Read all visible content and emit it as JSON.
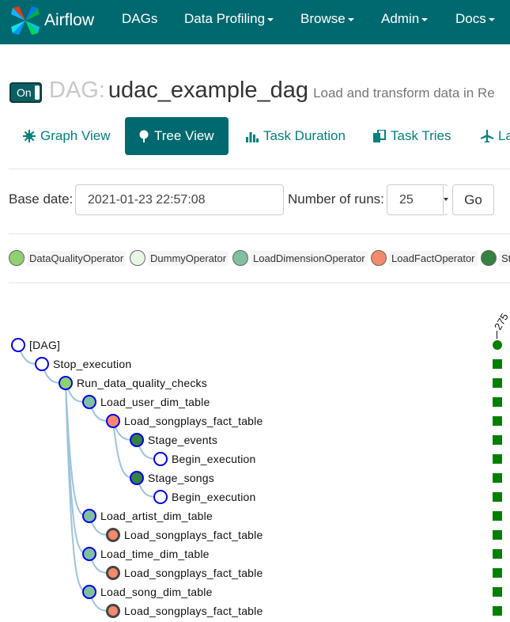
{
  "navbar": {
    "brand": "Airflow",
    "items": [
      {
        "label": "DAGs",
        "dropdown": false
      },
      {
        "label": "Data Profiling",
        "dropdown": true
      },
      {
        "label": "Browse",
        "dropdown": true
      },
      {
        "label": "Admin",
        "dropdown": true
      },
      {
        "label": "Docs",
        "dropdown": true
      }
    ]
  },
  "dag": {
    "toggle_label": "On",
    "prefix": "DAG:",
    "name": "udac_example_dag",
    "description": "Load and transform data in Re"
  },
  "tabs": [
    {
      "label": "Graph View",
      "icon": "asterisk-icon"
    },
    {
      "label": "Tree View",
      "icon": "tree-icon",
      "active": true
    },
    {
      "label": "Task Duration",
      "icon": "bar-chart-icon"
    },
    {
      "label": "Task Tries",
      "icon": "duplicate-icon"
    },
    {
      "label": "La",
      "icon": "plane-icon"
    }
  ],
  "controls": {
    "base_date_label": "Base date:",
    "base_date_value": "2021-01-23 22:57:08",
    "num_runs_label": "Number of runs:",
    "num_runs_value": "25",
    "go_label": "Go"
  },
  "legend": [
    {
      "label": "DataQualityOperator",
      "color": "#8fd16e"
    },
    {
      "label": "DummyOperator",
      "color": "#e8f7e4"
    },
    {
      "label": "LoadDimensionOperator",
      "color": "#80c0a0"
    },
    {
      "label": "LoadFactOperator",
      "color": "#f4896d"
    },
    {
      "label": "St",
      "color": "#358140"
    }
  ],
  "tree": {
    "run_label": "275",
    "nodes": [
      {
        "label": "[DAG]",
        "color": "#ffffff",
        "status_border": "#0000ee"
      },
      {
        "label": "Stop_execution",
        "color": "#ffffff",
        "status_border": "#0000ee"
      },
      {
        "label": "Run_data_quality_checks",
        "color": "#8fd16e",
        "status_border": "#0000ee"
      },
      {
        "label": "Load_user_dim_table",
        "color": "#80c0a0",
        "status_border": "#0000ee"
      },
      {
        "label": "Load_songplays_fact_table",
        "color": "#f4896d",
        "status_border": "#0000ee"
      },
      {
        "label": "Stage_events",
        "color": "#358140",
        "status_border": "#0000ee"
      },
      {
        "label": "Begin_execution",
        "color": "#ffffff",
        "status_border": "#0000ee"
      },
      {
        "label": "Stage_songs",
        "color": "#358140",
        "status_border": "#0000ee"
      },
      {
        "label": "Begin_execution",
        "color": "#ffffff",
        "status_border": "#0000ee"
      },
      {
        "label": "Load_artist_dim_table",
        "color": "#80c0a0",
        "status_border": "#0000ee"
      },
      {
        "label": "Load_songplays_fact_table",
        "color": "#f4896d",
        "status_border": "#444444"
      },
      {
        "label": "Load_time_dim_table",
        "color": "#80c0a0",
        "status_border": "#0000ee"
      },
      {
        "label": "Load_songplays_fact_table",
        "color": "#f4896d",
        "status_border": "#444444"
      },
      {
        "label": "Load_song_dim_table",
        "color": "#80c0a0",
        "status_border": "#0000ee"
      },
      {
        "label": "Load_songplays_fact_table",
        "color": "#f4896d",
        "status_border": "#444444"
      }
    ],
    "status_color": "#008000"
  }
}
